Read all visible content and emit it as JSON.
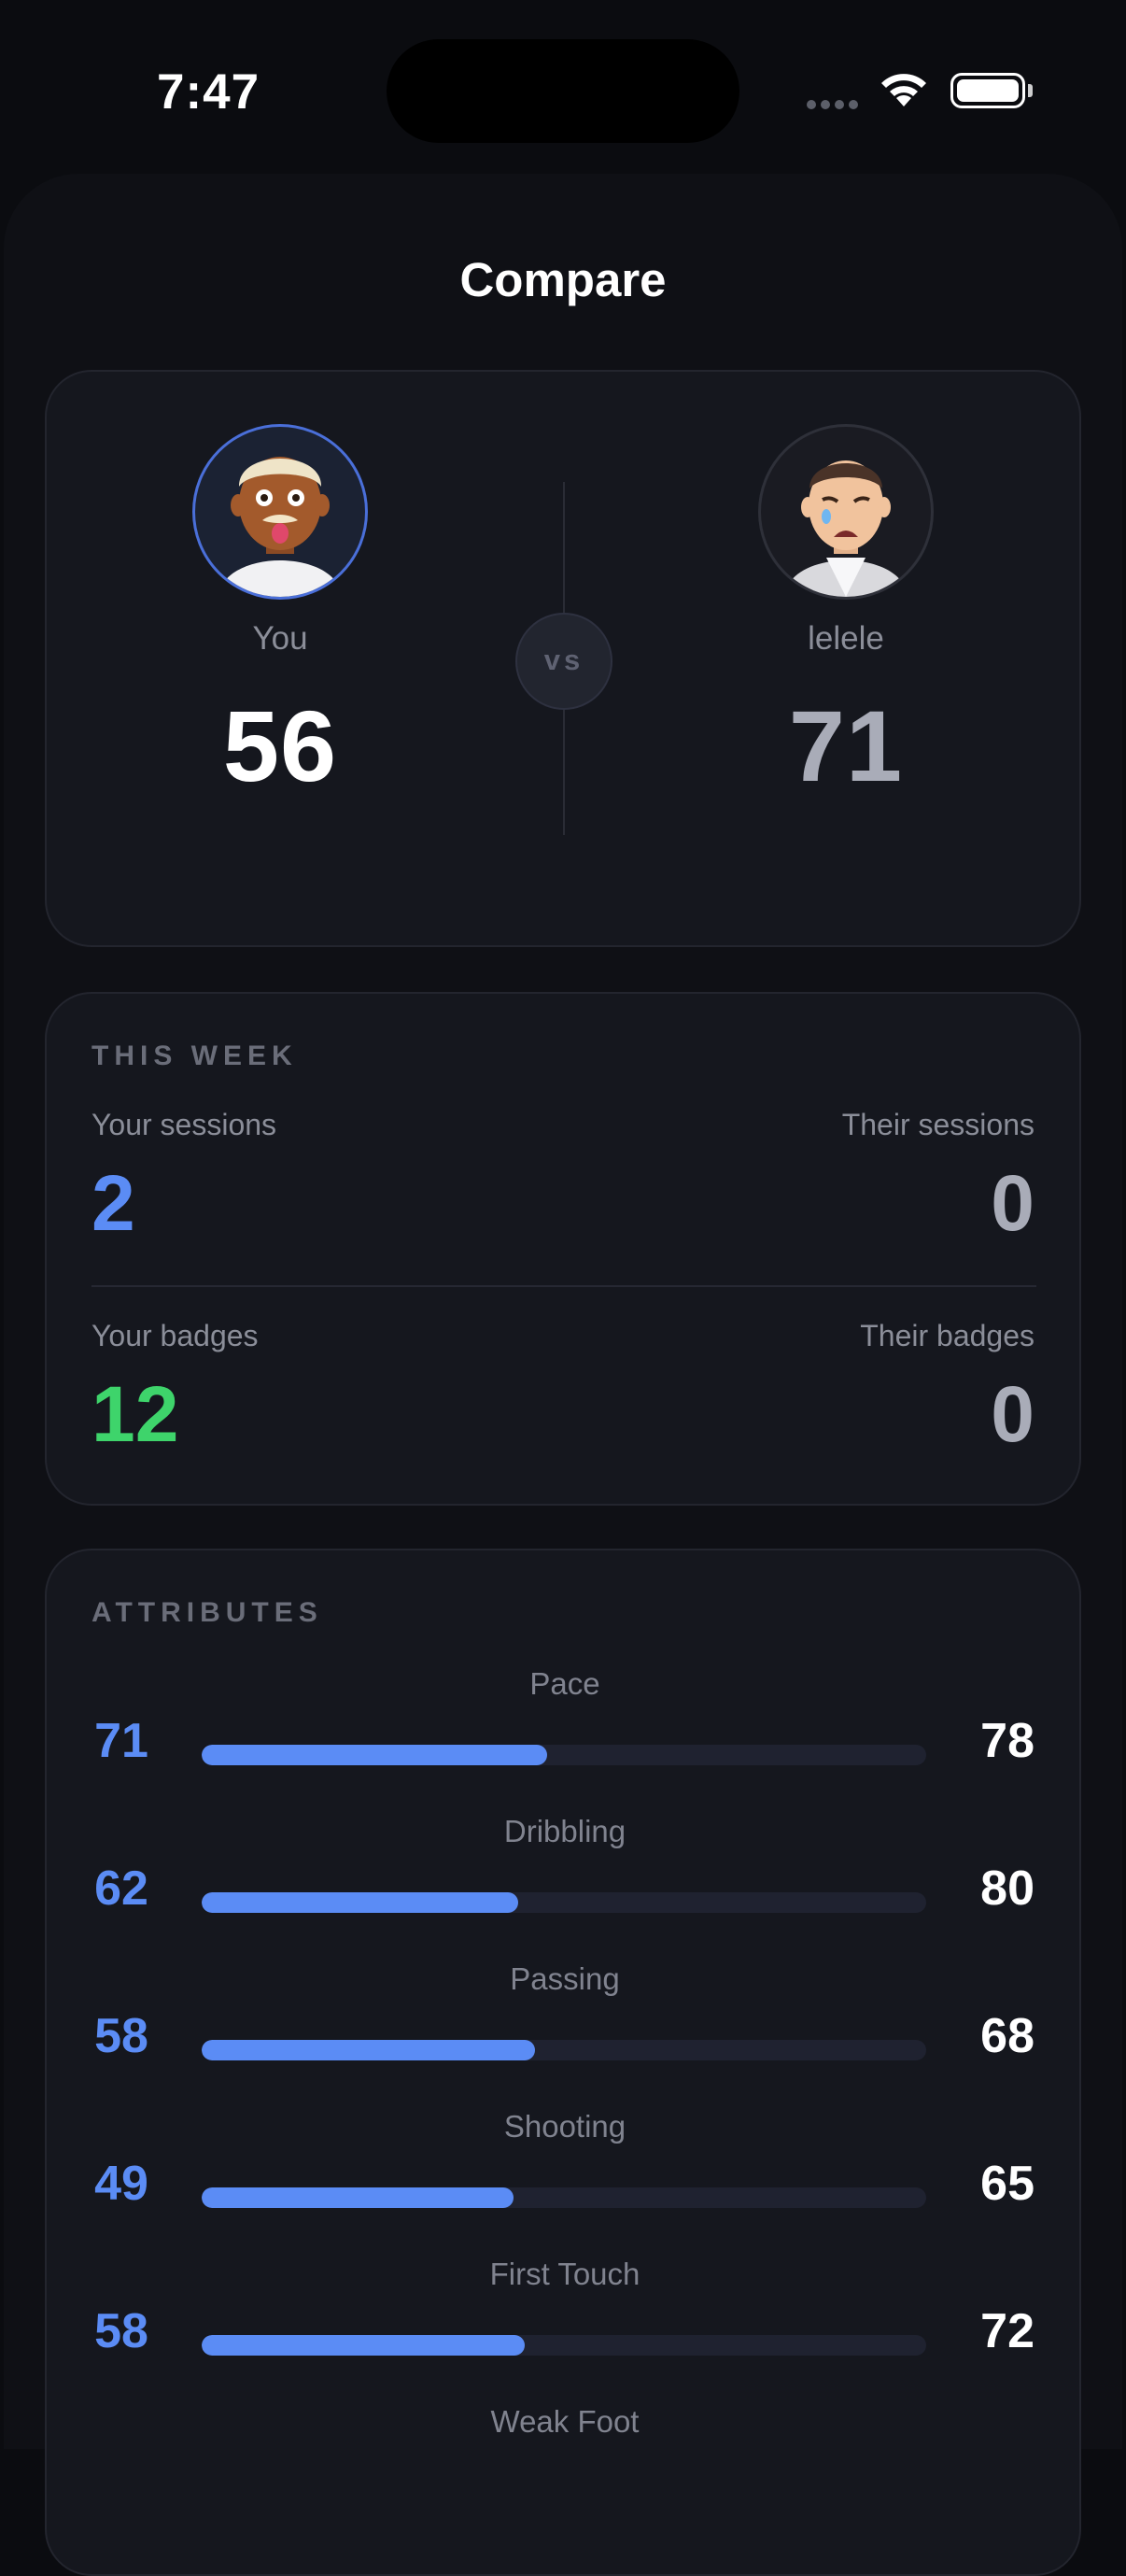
{
  "status": {
    "time": "7:47"
  },
  "title": "Compare",
  "players": {
    "you": {
      "name": "You",
      "score": "56"
    },
    "them": {
      "name": "lelele",
      "score": "71"
    },
    "vs": "vs"
  },
  "week": {
    "label": "THIS WEEK",
    "your_sessions_label": "Your sessions",
    "your_sessions": "2",
    "their_sessions_label": "Their sessions",
    "their_sessions": "0",
    "your_badges_label": "Your badges",
    "your_badges": "12",
    "their_badges_label": "Their badges",
    "their_badges": "0"
  },
  "colors": {
    "accent_blue": "#5b8cf5",
    "accent_green": "#3ed46b",
    "background": "#0b0c10",
    "card": "#15171e"
  },
  "attributes": {
    "label": "ATTRIBUTES",
    "items": [
      {
        "name": "Pace",
        "you": "71",
        "them": "78",
        "fill_ratio": 0.477
      },
      {
        "name": "Dribbling",
        "you": "62",
        "them": "80",
        "fill_ratio": 0.437
      },
      {
        "name": "Passing",
        "you": "58",
        "them": "68",
        "fill_ratio": 0.46
      },
      {
        "name": "Shooting",
        "you": "49",
        "them": "65",
        "fill_ratio": 0.43
      },
      {
        "name": "First Touch",
        "you": "58",
        "them": "72",
        "fill_ratio": 0.446
      },
      {
        "name": "Weak Foot",
        "you": "",
        "them": "",
        "fill_ratio": 0
      }
    ]
  }
}
